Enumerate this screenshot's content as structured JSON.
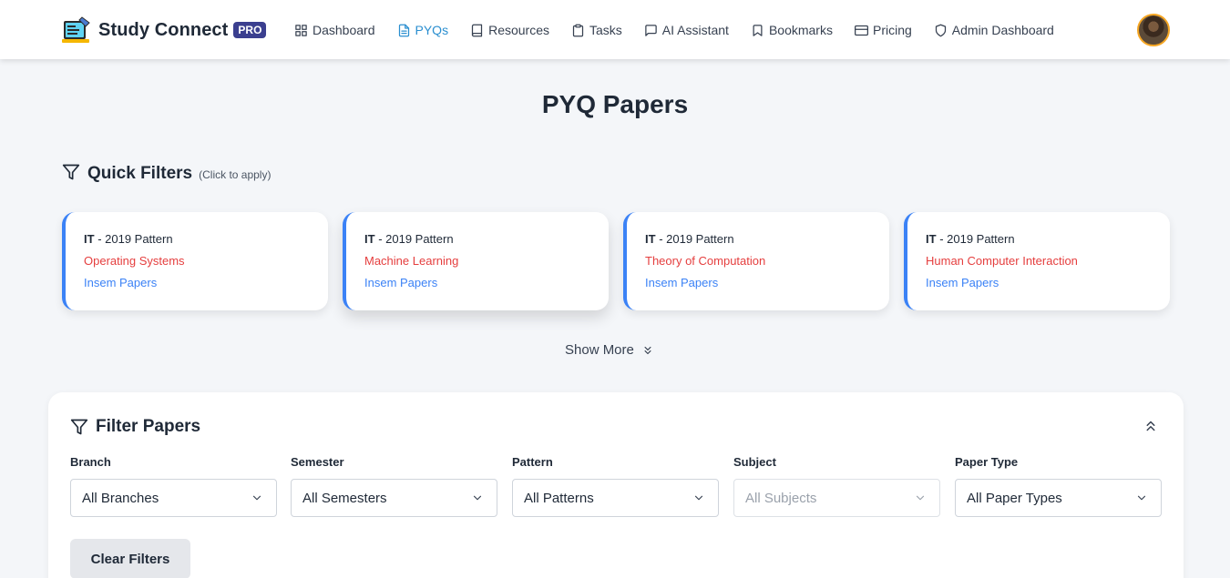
{
  "nav": {
    "brand": "Study Connect",
    "badge": "PRO",
    "items": [
      {
        "label": "Dashboard",
        "icon": "grid-icon"
      },
      {
        "label": "PYQs",
        "icon": "file-text-icon",
        "active": true
      },
      {
        "label": "Resources",
        "icon": "book-icon"
      },
      {
        "label": "Tasks",
        "icon": "clipboard-icon"
      },
      {
        "label": "AI Assistant",
        "icon": "message-square-icon"
      },
      {
        "label": "Bookmarks",
        "icon": "bookmark-icon"
      },
      {
        "label": "Pricing",
        "icon": "credit-card-icon"
      },
      {
        "label": "Admin Dashboard",
        "icon": "shield-icon"
      }
    ],
    "active_color": "#2b8fd0"
  },
  "page": {
    "title": "PYQ Papers"
  },
  "quick_filters": {
    "title": "Quick Filters",
    "hint": "(Click to apply)",
    "cards": [
      {
        "branch": "IT",
        "pattern": "- 2019 Pattern",
        "subject": "Operating Systems",
        "type": "Insem Papers"
      },
      {
        "branch": "IT",
        "pattern": "- 2019 Pattern",
        "subject": "Machine Learning",
        "type": "Insem Papers"
      },
      {
        "branch": "IT",
        "pattern": "- 2019 Pattern",
        "subject": "Theory of Computation",
        "type": "Insem Papers"
      },
      {
        "branch": "IT",
        "pattern": "- 2019 Pattern",
        "subject": "Human Computer Interaction",
        "type": "Insem Papers"
      }
    ],
    "show_more": "Show More"
  },
  "filter_panel": {
    "title": "Filter Papers",
    "fields": [
      {
        "label": "Branch",
        "value": "All Branches"
      },
      {
        "label": "Semester",
        "value": "All Semesters"
      },
      {
        "label": "Pattern",
        "value": "All Patterns"
      },
      {
        "label": "Subject",
        "value": "All Subjects",
        "disabled": true
      },
      {
        "label": "Paper Type",
        "value": "All Paper Types"
      }
    ],
    "clear_label": "Clear Filters"
  },
  "colors": {
    "accent": "#3b82f6",
    "subject": "#e53e3e",
    "badge": "#3b3f8f"
  }
}
